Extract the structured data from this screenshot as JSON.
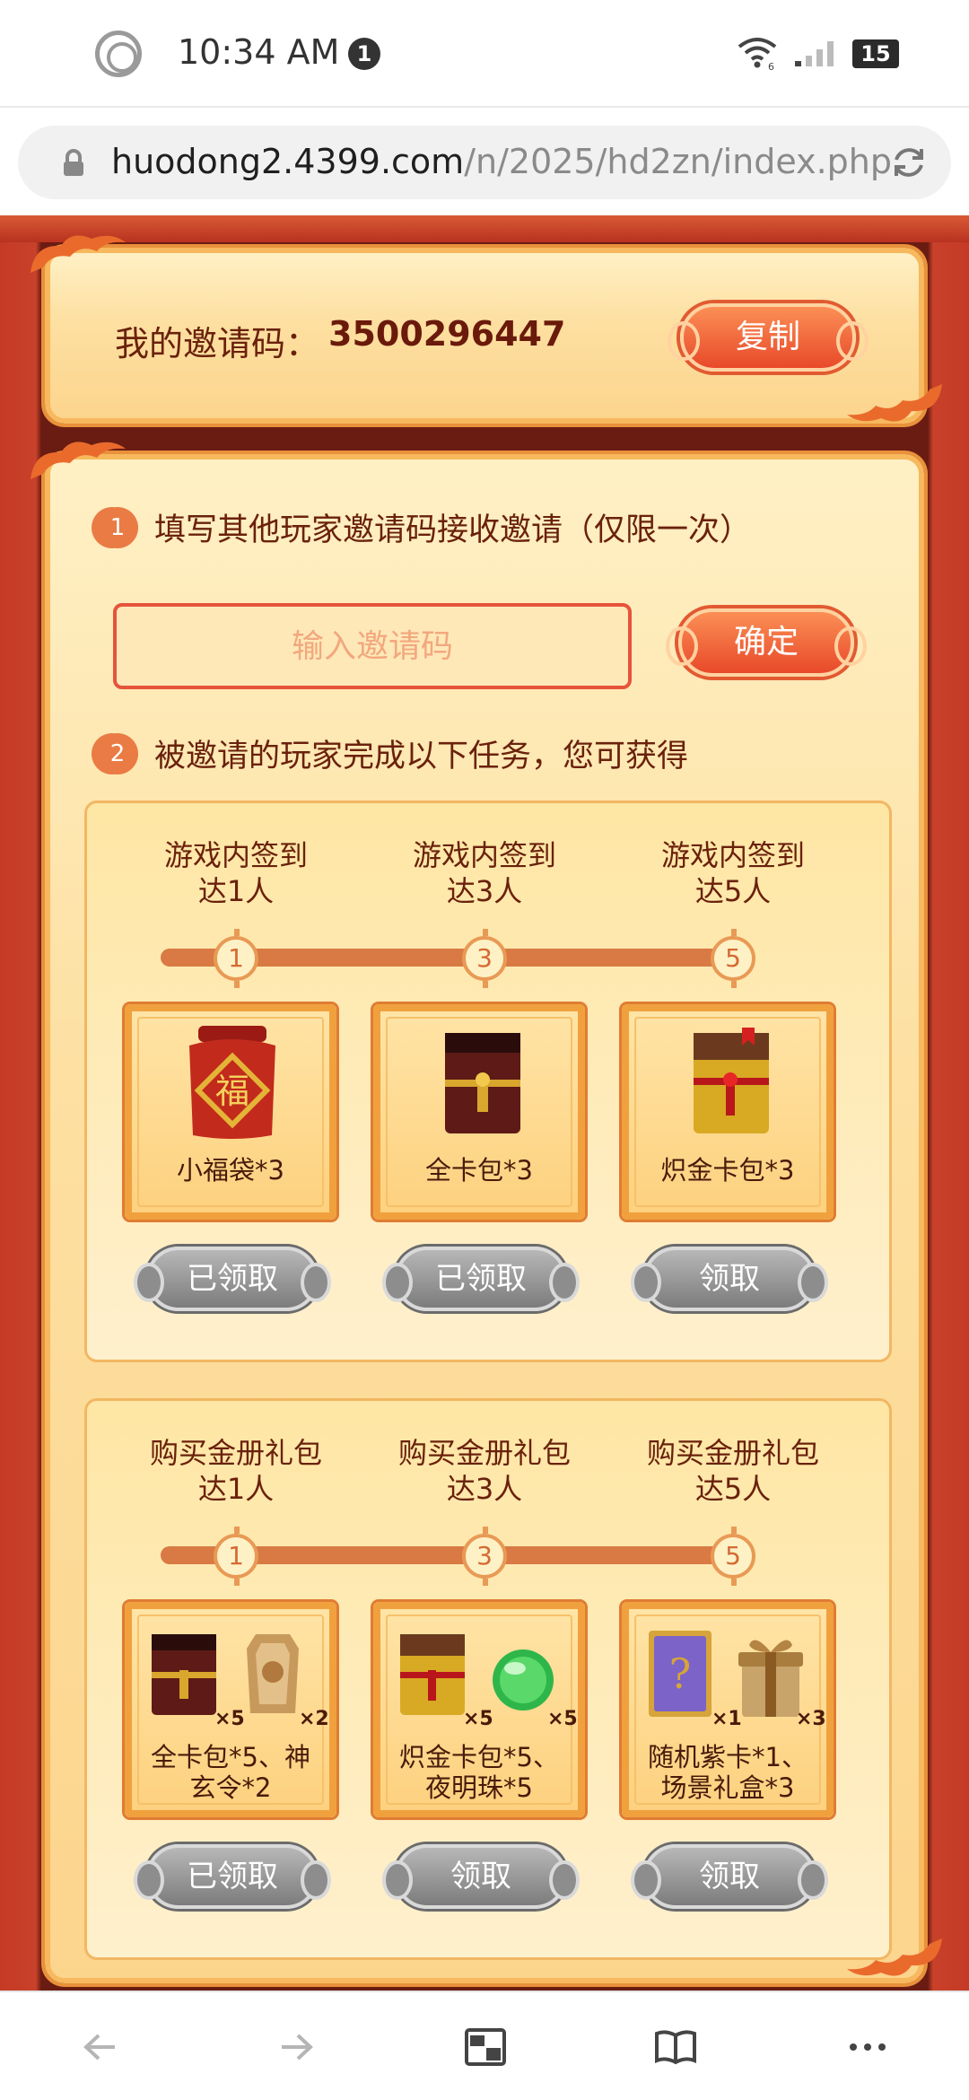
{
  "status_bar": {
    "time": "10:34 AM",
    "notification_count": "1",
    "battery": "15",
    "signal_label": "6"
  },
  "browser": {
    "url_host": "huodong2.4399.com",
    "url_path": "/n/2025/hd2zn/index.php"
  },
  "invite": {
    "label": "我的邀请码：",
    "code": "3500296447",
    "copy_label": "复制"
  },
  "step1": {
    "number": "1",
    "text": "填写其他玩家邀请码接收邀请（仅限一次）",
    "input_placeholder": "输入邀请码",
    "confirm_label": "确定"
  },
  "step2": {
    "number": "2",
    "text": "被邀请的玩家完成以下任务，您可获得"
  },
  "signin": {
    "milestones": [
      {
        "line1": "游戏内签到",
        "line2": "达1人",
        "node": "1",
        "reward": "小福袋*3",
        "button": "已领取"
      },
      {
        "line1": "游戏内签到",
        "line2": "达3人",
        "node": "3",
        "reward": "全卡包*3",
        "button": "已领取"
      },
      {
        "line1": "游戏内签到",
        "line2": "达5人",
        "node": "5",
        "reward": "炽金卡包*3",
        "button": "领取"
      }
    ]
  },
  "purchase": {
    "milestones": [
      {
        "line1": "购买金册礼包",
        "line2": "达1人",
        "node": "1",
        "reward_line1": "全卡包*5、神",
        "reward_line2": "玄令*2",
        "mult_a": "×5",
        "mult_b": "×2",
        "button": "已领取"
      },
      {
        "line1": "购买金册礼包",
        "line2": "达3人",
        "node": "3",
        "reward_line1": "炽金卡包*5、",
        "reward_line2": "夜明珠*5",
        "mult_a": "×5",
        "mult_b": "×5",
        "button": "领取"
      },
      {
        "line1": "购买金册礼包",
        "line2": "达5人",
        "node": "5",
        "reward_line1": "随机紫卡*1、",
        "reward_line2": "场景礼盒*3",
        "mult_a": "×1",
        "mult_b": "×3",
        "button": "领取"
      }
    ]
  },
  "icons": {
    "fudai_char": "福",
    "mystery_char": "?"
  },
  "colors": {
    "accent_red": "#e8492a",
    "panel_gold": "#fde0a2",
    "frame_dark": "#6a1c12",
    "claimed_gray": "#8d8d8d"
  }
}
